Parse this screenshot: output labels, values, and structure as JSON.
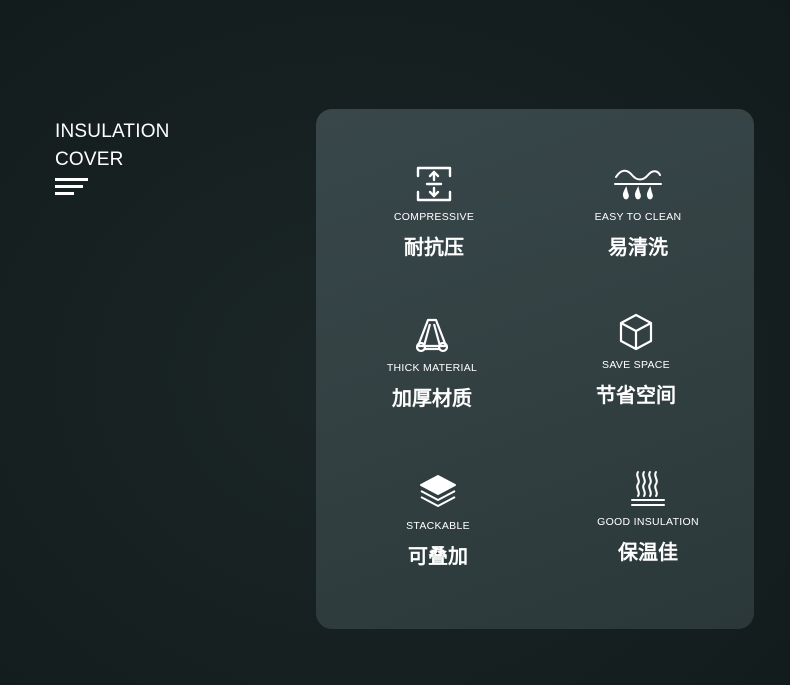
{
  "heading": {
    "line1": "INSULATION",
    "line2": "COVER"
  },
  "features": [
    {
      "icon": "compress-icon",
      "en": "COMPRESSIVE",
      "zh": "耐抗压"
    },
    {
      "icon": "water-drops-icon",
      "en": "EASY TO CLEAN",
      "zh": "易清洗"
    },
    {
      "icon": "layers-material-icon",
      "en": "THICK MATERIAL",
      "zh": "加厚材质"
    },
    {
      "icon": "cube-icon",
      "en": "SAVE SPACE",
      "zh": "节省空间"
    },
    {
      "icon": "stack-icon",
      "en": "STACKABLE",
      "zh": "可叠加"
    },
    {
      "icon": "heat-icon",
      "en": "GOOD INSULATION",
      "zh": "保温佳"
    }
  ],
  "colors": {
    "background": "#172121",
    "panel": "#334143",
    "text": "#ffffff"
  }
}
